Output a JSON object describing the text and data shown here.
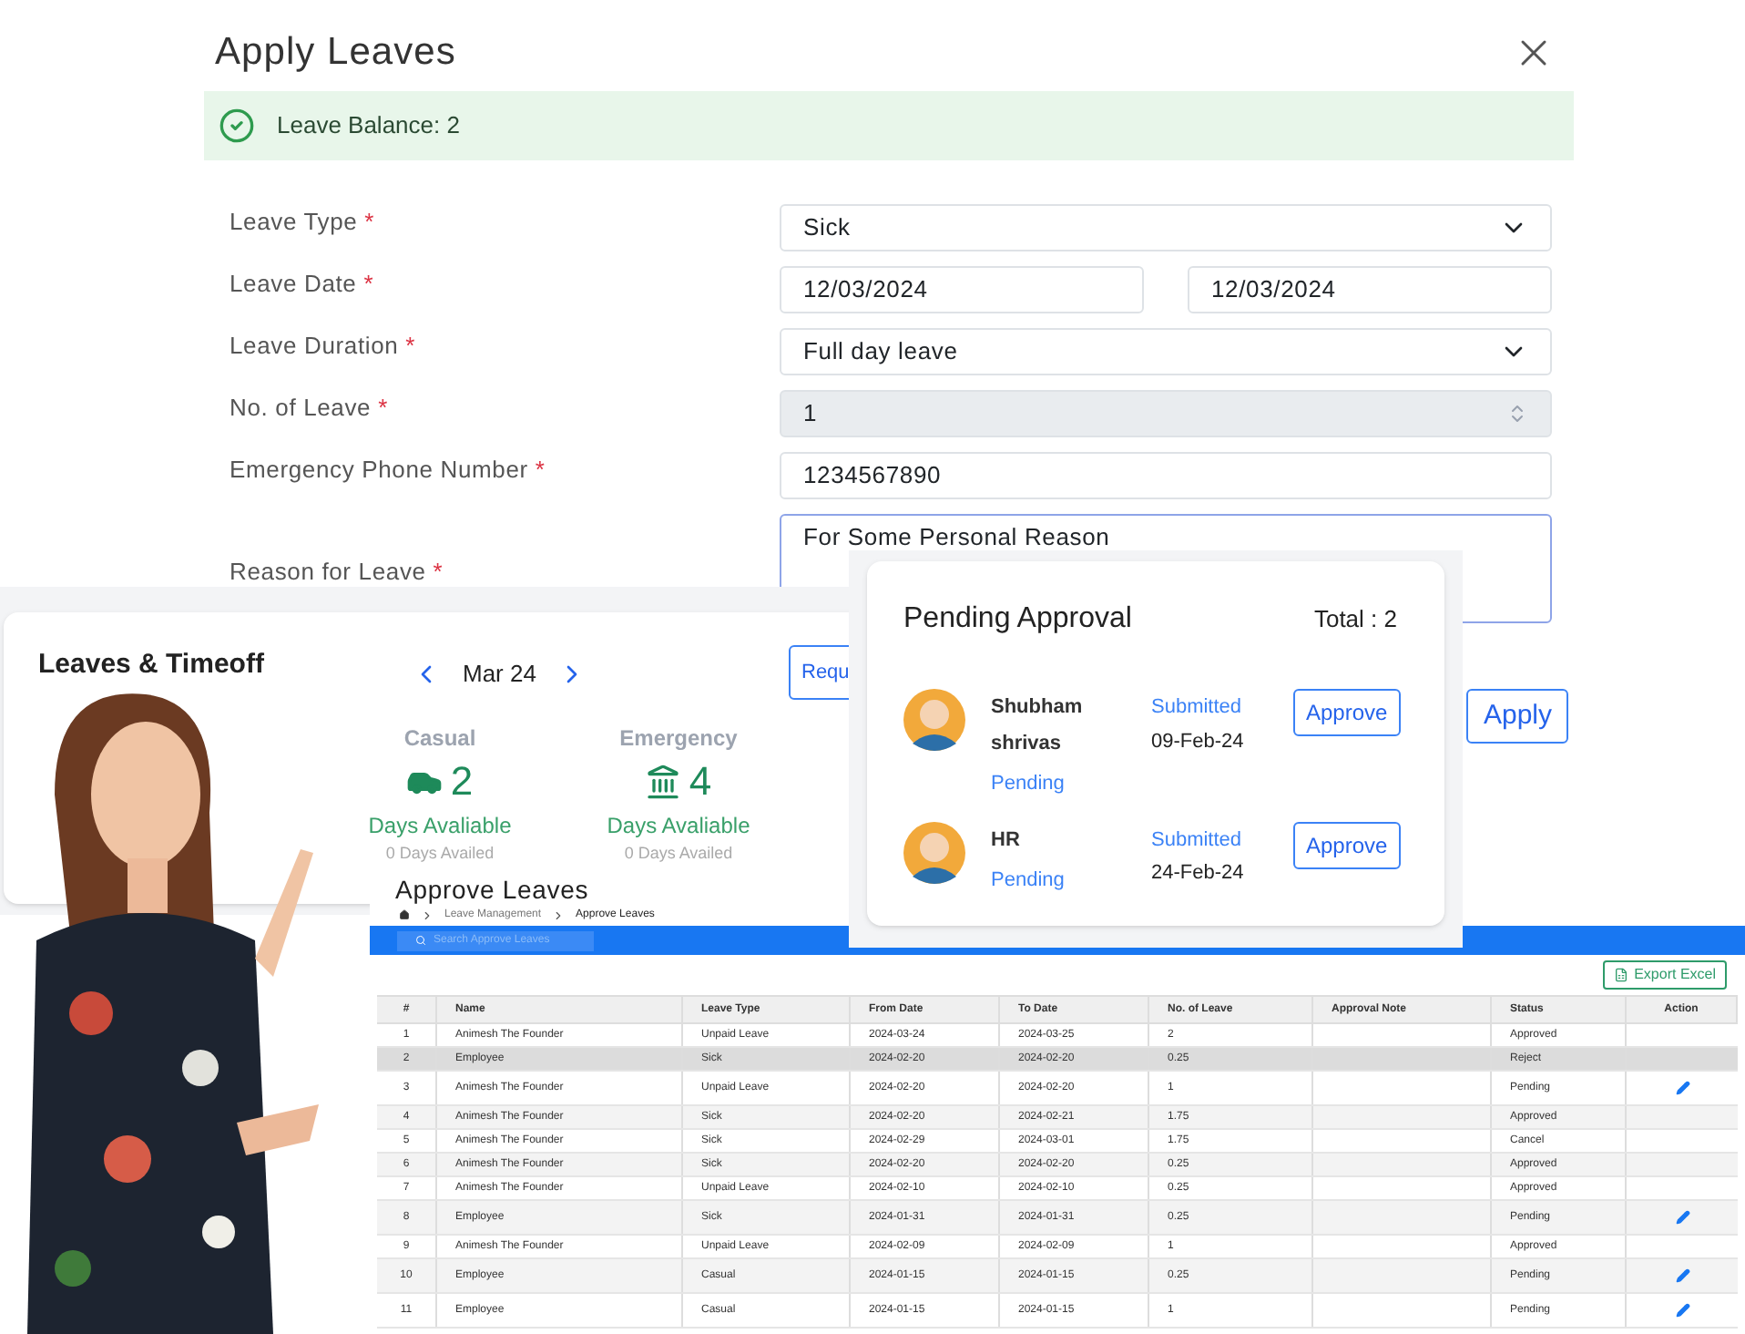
{
  "apply_dialog": {
    "title": "Apply Leaves",
    "balance": "Leave Balance: 2",
    "fields": [
      {
        "kind": "select",
        "label": "Leave Type",
        "mark": "*",
        "value": "Sick"
      },
      {
        "kind": "date_range",
        "label": "Leave Date",
        "mark": "*",
        "values": [
          "12/03/2024",
          "12/03/2024"
        ]
      },
      {
        "kind": "select",
        "label": "Leave Duration",
        "mark": "*",
        "value": "Full day leave"
      },
      {
        "kind": "number",
        "label": "No. of Leave",
        "mark": "*",
        "value": "1",
        "disabled": true
      },
      {
        "kind": "text",
        "label": "Emergency Phone Number",
        "mark": "*",
        "value": "1234567890"
      },
      {
        "kind": "textarea",
        "label": "Reason for Leave",
        "mark": "*",
        "value": "For Some Personal Reason"
      }
    ],
    "apply_button": "Apply"
  },
  "leaves_card": {
    "title": "Leaves & Timeoff",
    "month": "Mar 24",
    "request_button": "Requ",
    "types": [
      {
        "kind": "car",
        "name": "Casual",
        "count": "2",
        "available": "Days Avaliable",
        "availed": "0 Days Availed"
      },
      {
        "kind": "bank",
        "name": "Emergency",
        "count": "4",
        "available": "Days Avaliable",
        "availed": "0 Days Availed"
      }
    ]
  },
  "pending_card": {
    "title": "Pending Approval",
    "total": "Total : 2",
    "items": [
      {
        "name": "Shubham shrivas",
        "status": "Pending",
        "submitted": "Submitted",
        "date": "09-Feb-24",
        "button": "Approve"
      },
      {
        "name": "HR",
        "status": "Pending",
        "submitted": "Submitted",
        "date": "24-Feb-24",
        "button": "Approve"
      }
    ]
  },
  "approve_panel": {
    "title": "Approve Leaves",
    "breadcrumb": [
      "Leave Management",
      "Approve Leaves"
    ],
    "search": {
      "placeholder": "Search Approve Leaves"
    },
    "export_button": "Export Excel",
    "columns": [
      "#",
      "Name",
      "Leave Type",
      "From Date",
      "To Date",
      "No. of Leave",
      "Approval Note",
      "Status",
      "Action"
    ],
    "rows": [
      {
        "cells": [
          "1",
          "Animesh The Founder",
          "Unpaid Leave",
          "2024-03-24",
          "2024-03-25",
          "2",
          "",
          "Approved"
        ],
        "editable": false,
        "selected": false
      },
      {
        "cells": [
          "2",
          "Employee",
          "Sick",
          "2024-02-20",
          "2024-02-20",
          "0.25",
          "",
          "Reject"
        ],
        "editable": false,
        "selected": true
      },
      {
        "cells": [
          "3",
          "Animesh The Founder",
          "Unpaid Leave",
          "2024-02-20",
          "2024-02-20",
          "1",
          "",
          "Pending"
        ],
        "editable": true,
        "selected": false
      },
      {
        "cells": [
          "4",
          "Animesh The Founder",
          "Sick",
          "2024-02-20",
          "2024-02-21",
          "1.75",
          "",
          "Approved"
        ],
        "editable": false,
        "selected": false
      },
      {
        "cells": [
          "5",
          "Animesh The Founder",
          "Sick",
          "2024-02-29",
          "2024-03-01",
          "1.75",
          "",
          "Cancel"
        ],
        "editable": false,
        "selected": false
      },
      {
        "cells": [
          "6",
          "Animesh The Founder",
          "Sick",
          "2024-02-20",
          "2024-02-20",
          "0.25",
          "",
          "Approved"
        ],
        "editable": false,
        "selected": false
      },
      {
        "cells": [
          "7",
          "Animesh The Founder",
          "Unpaid Leave",
          "2024-02-10",
          "2024-02-10",
          "0.25",
          "",
          "Approved"
        ],
        "editable": false,
        "selected": false
      },
      {
        "cells": [
          "8",
          "Employee",
          "Sick",
          "2024-01-31",
          "2024-01-31",
          "0.25",
          "",
          "Pending"
        ],
        "editable": true,
        "selected": false
      },
      {
        "cells": [
          "9",
          "Animesh The Founder",
          "Unpaid Leave",
          "2024-02-09",
          "2024-02-09",
          "1",
          "",
          "Approved"
        ],
        "editable": false,
        "selected": false
      },
      {
        "cells": [
          "10",
          "Employee",
          "Casual",
          "2024-01-15",
          "2024-01-15",
          "0.25",
          "",
          "Pending"
        ],
        "editable": true,
        "selected": false
      },
      {
        "cells": [
          "11",
          "Employee",
          "Casual",
          "2024-01-15",
          "2024-01-15",
          "1",
          "",
          "Pending"
        ],
        "editable": true,
        "selected": false
      }
    ]
  }
}
